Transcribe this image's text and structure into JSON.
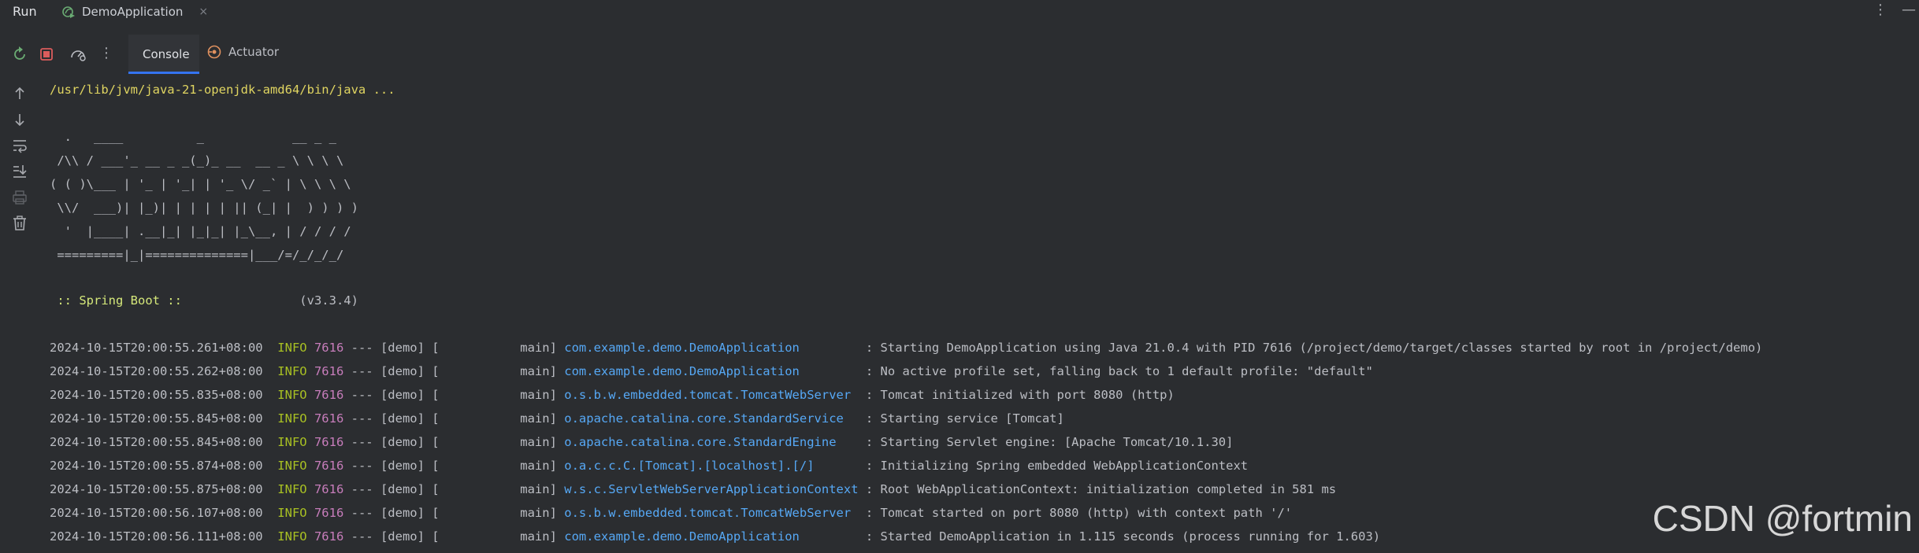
{
  "header": {
    "run_label": "Run",
    "tab_label": "DemoApplication",
    "tab_close": "×",
    "more": "⋮",
    "minimize": "—"
  },
  "toolbar": {
    "console_tab": "Console",
    "actuator_tab": "Actuator",
    "more": "⋮"
  },
  "console": {
    "command": "/usr/lib/jvm/java-21-openjdk-amd64/bin/java ...",
    "banner": [
      "  .   ____          _            __ _ _",
      " /\\\\ / ___'_ __ _ _(_)_ __  __ _ \\ \\ \\ \\",
      "( ( )\\___ | '_ | '_| | '_ \\/ _` | \\ \\ \\ \\",
      " \\\\/  ___)| |_)| | | | | || (_| |  ) ) ) )",
      "  '  |____| .__|_| |_|_| |_\\__, | / / / /",
      " =========|_|==============|___/=/_/_/_/"
    ],
    "spring_boot_label": " :: Spring Boot :: ",
    "spring_boot_version": "               (v3.3.4)",
    "logs": [
      {
        "ts": "2024-10-15T20:00:55.261+08:00",
        "level": "INFO",
        "pid": "7616",
        "mid": " --- [demo] [           main] ",
        "logger": "com.example.demo.DemoApplication",
        "pad": "         ",
        "msg": ": Starting DemoApplication using Java 21.0.4 with PID 7616 (/project/demo/target/classes started by root in /project/demo)"
      },
      {
        "ts": "2024-10-15T20:00:55.262+08:00",
        "level": "INFO",
        "pid": "7616",
        "mid": " --- [demo] [           main] ",
        "logger": "com.example.demo.DemoApplication",
        "pad": "         ",
        "msg": ": No active profile set, falling back to 1 default profile: \"default\""
      },
      {
        "ts": "2024-10-15T20:00:55.835+08:00",
        "level": "INFO",
        "pid": "7616",
        "mid": " --- [demo] [           main] ",
        "logger": "o.s.b.w.embedded.tomcat.TomcatWebServer",
        "pad": "  ",
        "msg": ": Tomcat initialized with port 8080 (http)"
      },
      {
        "ts": "2024-10-15T20:00:55.845+08:00",
        "level": "INFO",
        "pid": "7616",
        "mid": " --- [demo] [           main] ",
        "logger": "o.apache.catalina.core.StandardService",
        "pad": "   ",
        "msg": ": Starting service [Tomcat]"
      },
      {
        "ts": "2024-10-15T20:00:55.845+08:00",
        "level": "INFO",
        "pid": "7616",
        "mid": " --- [demo] [           main] ",
        "logger": "o.apache.catalina.core.StandardEngine",
        "pad": "    ",
        "msg": ": Starting Servlet engine: [Apache Tomcat/10.1.30]"
      },
      {
        "ts": "2024-10-15T20:00:55.874+08:00",
        "level": "INFO",
        "pid": "7616",
        "mid": " --- [demo] [           main] ",
        "logger": "o.a.c.c.C.[Tomcat].[localhost].[/]",
        "pad": "       ",
        "msg": ": Initializing Spring embedded WebApplicationContext"
      },
      {
        "ts": "2024-10-15T20:00:55.875+08:00",
        "level": "INFO",
        "pid": "7616",
        "mid": " --- [demo] [           main] ",
        "logger": "w.s.c.ServletWebServerApplicationContext",
        "pad": " ",
        "msg": ": Root WebApplicationContext: initialization completed in 581 ms"
      },
      {
        "ts": "2024-10-15T20:00:56.107+08:00",
        "level": "INFO",
        "pid": "7616",
        "mid": " --- [demo] [           main] ",
        "logger": "o.s.b.w.embedded.tomcat.TomcatWebServer",
        "pad": "  ",
        "msg": ": Tomcat started on port 8080 (http) with context path '/'"
      },
      {
        "ts": "2024-10-15T20:00:56.111+08:00",
        "level": "INFO",
        "pid": "7616",
        "mid": " --- [demo] [           main] ",
        "logger": "com.example.demo.DemoApplication",
        "pad": "         ",
        "msg": ": Started DemoApplication in 1.115 seconds (process running for 1.603)"
      }
    ]
  },
  "watermark": "CSDN @fortmin",
  "icons": {
    "tab": "spring-run-icon",
    "toolbar": [
      "rerun-icon",
      "stop-icon",
      "dashboard-icon",
      "more-icon"
    ],
    "actuator": "actuator-icon",
    "side": [
      "scroll-up-icon",
      "scroll-down-icon",
      "soft-wrap-icon",
      "scroll-to-end-icon",
      "print-icon",
      "clear-icon"
    ]
  },
  "colors": {
    "background": "#2b2d30",
    "command": "#e0d561",
    "level": "#a8c023",
    "pid": "#c77dbb",
    "logger": "#56a8f5",
    "accent": "#3574f0",
    "stop": "#db5c5c"
  }
}
